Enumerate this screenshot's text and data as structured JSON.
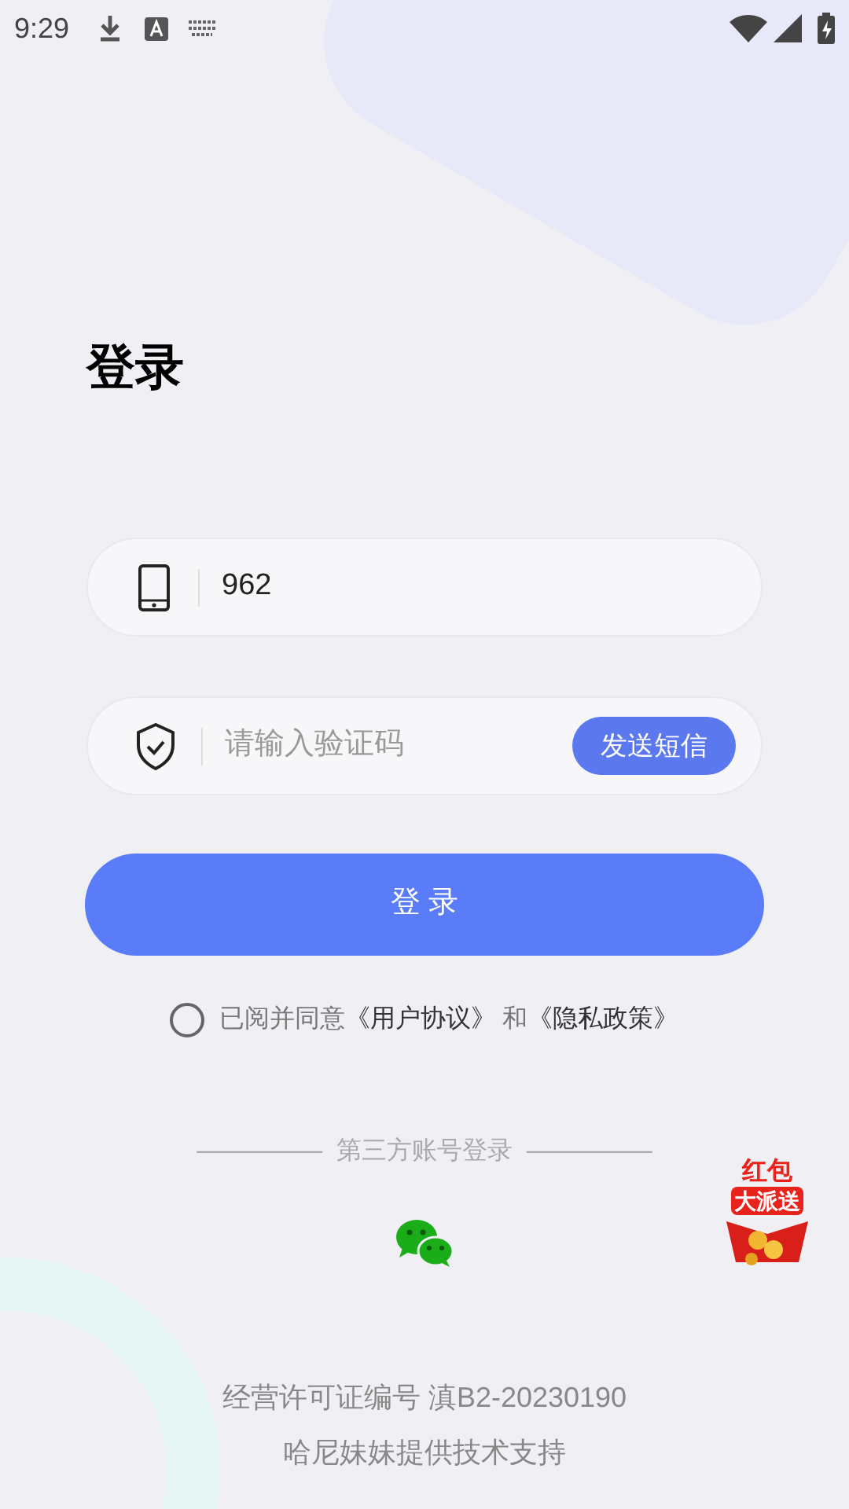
{
  "status_bar": {
    "time": "9:29"
  },
  "title": "登录",
  "phone_field": {
    "value": "962"
  },
  "code_field": {
    "placeholder": "请输入验证码",
    "send_button": "发送短信"
  },
  "login_button": "登 录",
  "agreement": {
    "checked": false,
    "prefix": "已阅并同意",
    "links": [
      "《用户协议》",
      "《隐私政策》"
    ],
    "joiner": "和"
  },
  "third_party": {
    "label": "—————  第三方账号登录  —————"
  },
  "promo_badge": {
    "line_1": "红包",
    "line_2": "大派送"
  },
  "footer": {
    "license": "经营许可证编号 滇B2-20230190",
    "support": "哈尼妹妹提供技术支持"
  }
}
